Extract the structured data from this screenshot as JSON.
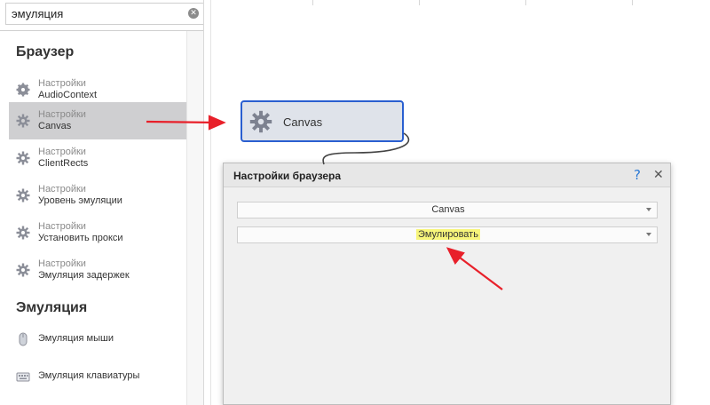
{
  "search": {
    "value": "эмуляция"
  },
  "sections": {
    "browser": "Браузер",
    "emulation": "Эмуляция"
  },
  "browser_items": [
    {
      "line1": "Настройки",
      "line2": "AudioContext"
    },
    {
      "line1": "Настройки",
      "line2": "Canvas"
    },
    {
      "line1": "Настройки",
      "line2": "ClientRects"
    },
    {
      "line1": "Настройки",
      "line2": "Уровень эмуляции"
    },
    {
      "line1": "Настройки",
      "line2": "Установить прокси"
    },
    {
      "line1": "Настройки",
      "line2": "Эмуляция задержек"
    }
  ],
  "emulation_items": [
    {
      "label": "Эмуляция мыши"
    },
    {
      "label": "Эмуляция клавиатуры"
    }
  ],
  "node": {
    "label": "Canvas"
  },
  "dialog": {
    "title": "Настройки браузера",
    "help": "?",
    "close": "✕",
    "select1": "Canvas",
    "select2": "Эмулировать"
  },
  "colors": {
    "arrow": "#e8202a",
    "node_border": "#2a5fd0",
    "highlight": "#f7f57a",
    "selected_bg": "#cfcfd1"
  }
}
